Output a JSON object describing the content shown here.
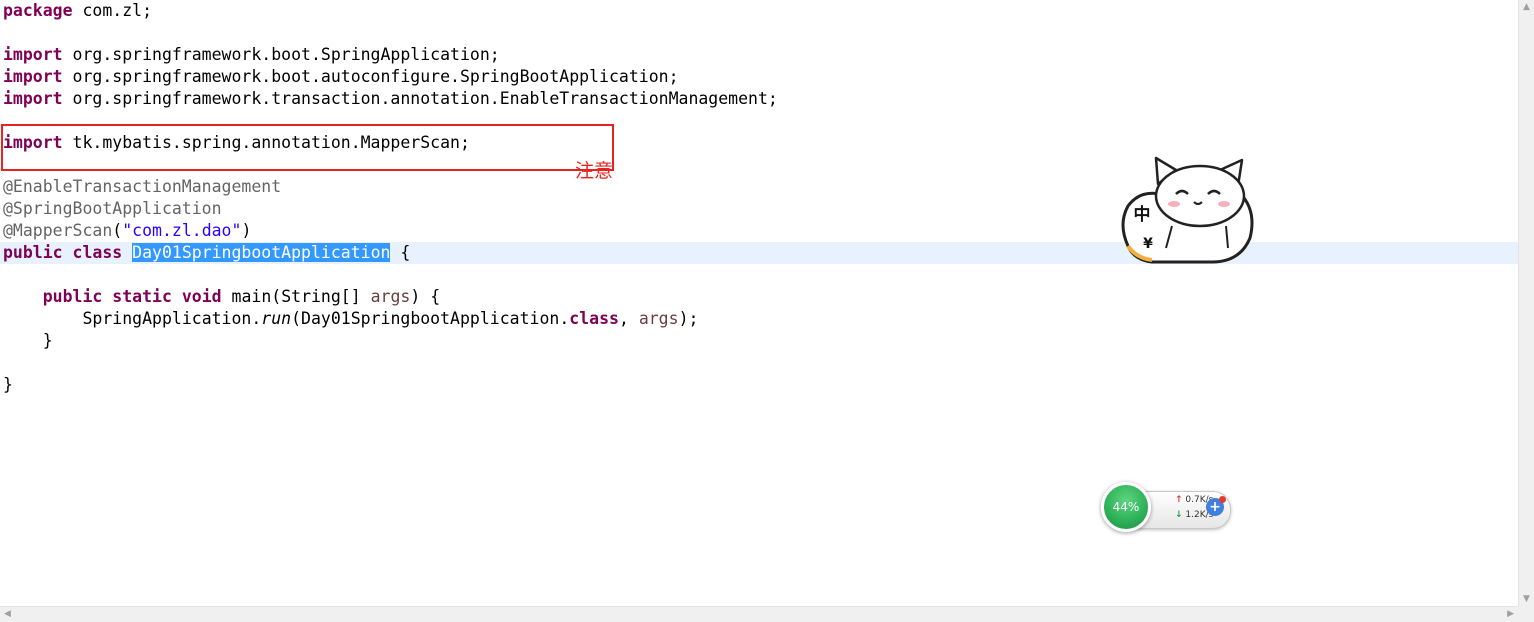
{
  "code": {
    "package_kw": "package",
    "package_name": " com.zl;",
    "imports": [
      {
        "kw": "import",
        "path": " org.springframework.boot.SpringApplication;"
      },
      {
        "kw": "import",
        "path": " org.springframework.boot.autoconfigure.SpringBootApplication;"
      },
      {
        "kw": "import",
        "path": " org.springframework.transaction.annotation.EnableTransactionManagement;"
      },
      {
        "kw": "import",
        "path": " tk.mybatis.spring.annotation.MapperScan;"
      }
    ],
    "annotations": {
      "enable_tx": "@EnableTransactionManagement",
      "spring_boot_app": "@SpringBootApplication",
      "mapper_scan": "@MapperScan",
      "mapper_scan_open": "(",
      "mapper_scan_value": "\"com.zl.dao\"",
      "mapper_scan_close": ")"
    },
    "class_decl": {
      "public_kw": "public",
      "class_kw": "class",
      "name": "Day01SpringbootApplication",
      "open_brace": " {"
    },
    "main_method": {
      "modifiers": [
        "public",
        "static",
        "void"
      ],
      "signature_start": " main(String[] ",
      "param": "args",
      "signature_end": ") {"
    },
    "run_call": {
      "receiver": "SpringApplication.",
      "method": "run",
      "arg_start": "(Day01SpringbootApplication.",
      "class_kw": "class",
      "arg_sep": ", ",
      "arg": "args",
      "end": ");"
    },
    "method_close": "}",
    "class_close": "}"
  },
  "annotation_note": "注意",
  "ime_widget": {
    "mode_char": "中",
    "symbol_char": "¥"
  },
  "net_monitor": {
    "percent": "44%",
    "upload": "0.7K/s",
    "download": "1.2K/s",
    "up_arrow": "↑",
    "down_arrow": "↓",
    "plus": "+"
  },
  "colors": {
    "keyword": "#7f0055",
    "annotation": "#646464",
    "string": "#2a00ff",
    "parameter": "#6a3e3e",
    "selection": "#3399ff",
    "current_line": "#e8f2fe",
    "highlight_box": "#e8231f"
  }
}
